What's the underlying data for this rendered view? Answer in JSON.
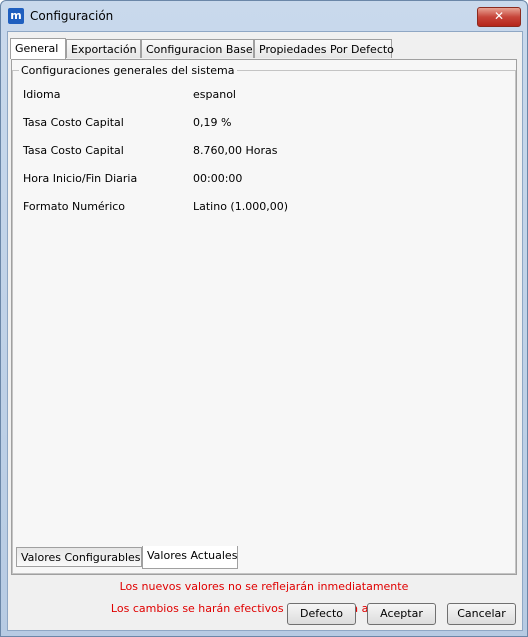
{
  "window": {
    "title": "Configuración",
    "icon_letter": "m",
    "close_glyph": "✕"
  },
  "tabs": [
    "General",
    "Exportación",
    "Configuracion Base",
    "Propiedades Por Defecto"
  ],
  "active_tab": "General",
  "group": {
    "label": "Configuraciones generales del sistema",
    "rows": [
      {
        "label": "Idioma",
        "value": "espanol"
      },
      {
        "label": "Tasa Costo Capital",
        "value": "0,19 %"
      },
      {
        "label": "Tasa Costo Capital",
        "value": "8.760,00 Horas"
      },
      {
        "label": "Hora Inicio/Fin Diaria",
        "value": "00:00:00"
      },
      {
        "label": "Formato Numérico",
        "value": "Latino (1.000,00)"
      }
    ]
  },
  "bottom_tabs": [
    "Valores Configurables",
    "Valores Actuales"
  ],
  "active_bottom_tab": "Valores Actuales",
  "messages": {
    "line1": "Los nuevos valores no se reflejarán inmediatamente",
    "line2": "Los cambios se harán efectivos al reiniciar la aplicación"
  },
  "buttons": {
    "default": "Defecto",
    "accept": "Aceptar",
    "cancel": "Cancelar"
  },
  "colors": {
    "message": "#e00000",
    "title_bar": "#c9d9ec",
    "close_button": "#c7453a"
  }
}
